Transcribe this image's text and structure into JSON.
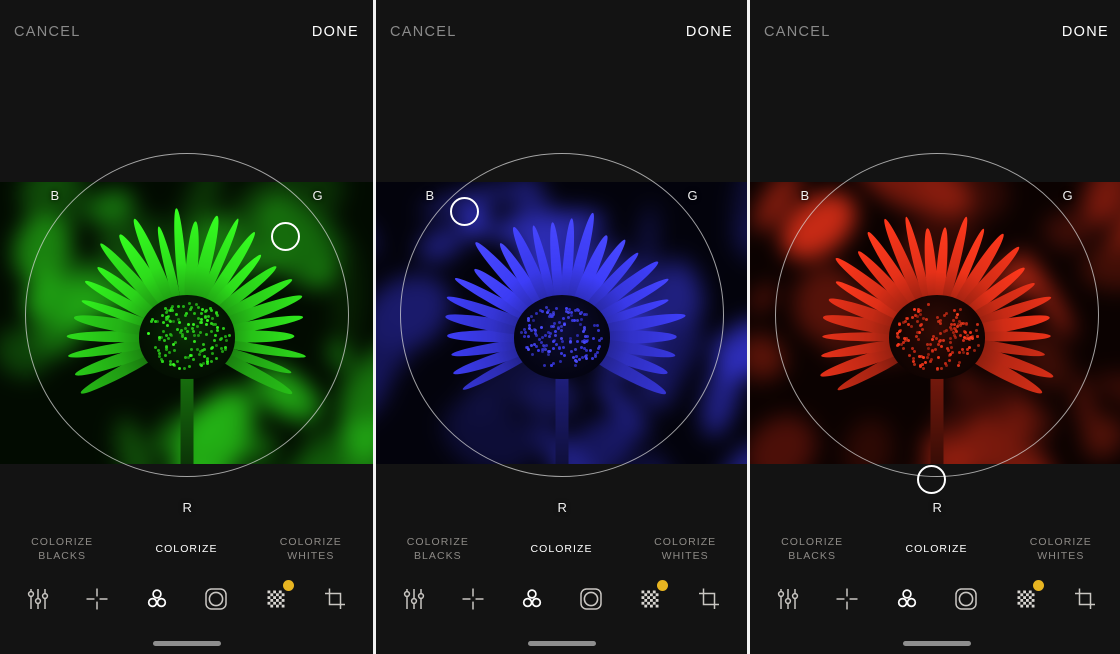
{
  "app": {
    "screenshot_width": 1120,
    "screenshot_height": 654,
    "background": "#131313",
    "divider_color": "#f2f2f2"
  },
  "topbar": {
    "cancel_label": "CANCEL",
    "done_label": "DONE",
    "cancel_color": "#8a8a8a",
    "done_color": "#ffffff"
  },
  "wheel": {
    "label_blue": "B",
    "label_green": "G",
    "label_red": "R",
    "ring_color": "#dcdcdc",
    "handle_color": "#ffffff"
  },
  "modes": {
    "left_line1": "COLORIZE",
    "left_line2": "BLACKS",
    "center_label": "COLORIZE",
    "right_line1": "COLORIZE",
    "right_line2": "WHITES",
    "active": "COLORIZE",
    "inactive_color": "#8d8a86",
    "active_color": "#ffffff"
  },
  "toolbar": {
    "items": [
      {
        "name": "adjust-sliders-icon",
        "label": "Adjust",
        "badge": false
      },
      {
        "name": "selective-crosshair-icon",
        "label": "Selective",
        "badge": false
      },
      {
        "name": "color-wheels-icon",
        "label": "Color",
        "badge": false
      },
      {
        "name": "vignette-icon",
        "label": "Vignette",
        "badge": false
      },
      {
        "name": "texture-checker-icon",
        "label": "Texture",
        "badge": true
      },
      {
        "name": "crop-icon",
        "label": "Crop",
        "badge": false
      }
    ],
    "active_index": 2,
    "badge_color": "#e8b521"
  },
  "panels": [
    {
      "id": "panel-green",
      "tint_name": "green",
      "tint_hex": "#2bd41a",
      "handle_x_pct": 80.7,
      "handle_y_pct": 25.9,
      "photo_subject": "coneflower"
    },
    {
      "id": "panel-blue",
      "tint_name": "blue",
      "tint_hex": "#3b3bef",
      "handle_x_pct": 20.0,
      "handle_y_pct": 18.1,
      "photo_subject": "coneflower"
    },
    {
      "id": "panel-red",
      "tint_name": "red",
      "tint_hex": "#e03018",
      "handle_x_pct": 48.5,
      "handle_y_pct": 100.7,
      "photo_subject": "coneflower"
    }
  ]
}
